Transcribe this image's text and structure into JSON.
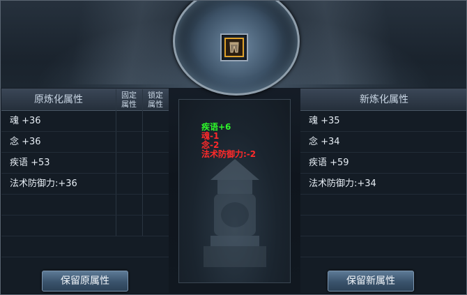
{
  "left_panel": {
    "title": "原炼化属性",
    "col_fixed": "固定\n属性",
    "col_locked": "锁定\n属性",
    "rows": [
      "魂 +36",
      "念 +36",
      "疾语 +53",
      "法术防御力:+36"
    ]
  },
  "right_panel": {
    "title": "新炼化属性",
    "rows": [
      "魂 +35",
      "念 +34",
      "疾语 +59",
      "法术防御力:+34"
    ]
  },
  "changes": [
    {
      "text": "疾语+6",
      "color": "#2df52a"
    },
    {
      "text": "魂-1",
      "color": "#ff2a2a"
    },
    {
      "text": "念-2",
      "color": "#ff2a2a"
    },
    {
      "text": "法术防御力:-2",
      "color": "#ff2a2a"
    }
  ],
  "buttons": {
    "keep_old": "保留原属性",
    "keep_new": "保留新属性"
  },
  "icons": {
    "equipment_slot": "pants-armor-icon"
  }
}
